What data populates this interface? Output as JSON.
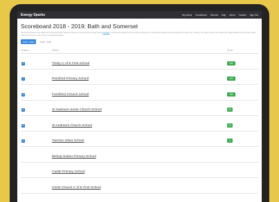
{
  "navbar": {
    "brand": "Energy Sparks",
    "links": [
      "My school",
      "Scoreboard",
      "Schools",
      "Map",
      "About",
      "Contact",
      "Sign Out"
    ]
  },
  "page": {
    "title": "Scoreboard 2018 - 2019: Bath and Somerset",
    "intro_before": "See how well each of our Bath and Somerset Energy Sparks schools are recording their energy saving",
    "intro_link": "activities",
    "intro_after": ". Schools are ranked on points that are earned from completing activities and recording their energy use. Schools, see which schools are making the biggest difference with their energy saving and improve your school's scoreboard position.",
    "tabs": {
      "active": "2018 - 2019",
      "inactive": "2019 - 2020"
    }
  },
  "table": {
    "headers": {
      "position": "Position",
      "school": "School",
      "score": "Score"
    },
    "rows": [
      {
        "position": "1",
        "school": "Trinity C of E First School",
        "score": "550"
      },
      {
        "position": "2",
        "school": "Pensford Primary School",
        "score": "340"
      },
      {
        "position": "3",
        "school": "Freshford Church School",
        "score": "285"
      },
      {
        "position": "4",
        "school": "St Saviours Junior Church School",
        "score": "50"
      },
      {
        "position": "5",
        "school": "St Andrew's Church School",
        "score": "25"
      },
      {
        "position": "6",
        "school": "Twerton Infant School",
        "score": "5"
      },
      {
        "position": "",
        "school": "Bishop Sutton Primary School",
        "score": ""
      },
      {
        "position": "",
        "school": "Castle Primary School",
        "score": ""
      },
      {
        "position": "",
        "school": "Christ Church C of E First School",
        "score": ""
      }
    ]
  },
  "colors": {
    "accent": "#3b8cdd",
    "score_badge": "#3aa84a",
    "navbar": "#2f3036",
    "background": "#e8c84a"
  }
}
